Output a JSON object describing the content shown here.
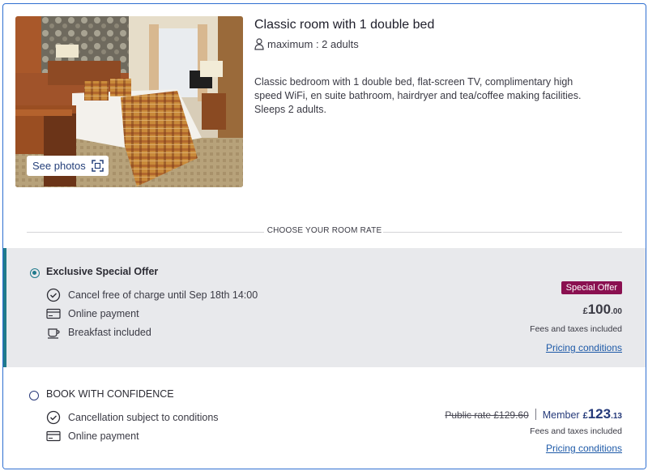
{
  "room": {
    "title": "Classic room with 1 double bed",
    "capacity": "maximum : 2 adults",
    "description": "Classic bedroom with 1 double bed, flat-screen TV, complimentary high speed WiFi, en suite bathroom, hairdryer and tea/coffee making facilities. Sleeps 2 adults.",
    "see_photos_label": "See photos"
  },
  "rate_section_label": "CHOOSE YOUR ROOM RATE",
  "rates": [
    {
      "name": "Exclusive Special Offer",
      "selected": true,
      "features": [
        {
          "icon": "clock-check-icon",
          "label": "Cancel free of charge until Sep 18th 14:00"
        },
        {
          "icon": "card-icon",
          "label": "Online payment"
        },
        {
          "icon": "cup-icon",
          "label": "Breakfast included"
        }
      ],
      "badge": "Special Offer",
      "currency": "£",
      "price_whole": "100",
      "price_cents": ".00",
      "fees_note": "Fees and taxes included",
      "pricing_link": "Pricing conditions"
    },
    {
      "name": "BOOK WITH CONFIDENCE",
      "selected": false,
      "features": [
        {
          "icon": "clock-check-icon",
          "label": "Cancellation subject to conditions"
        },
        {
          "icon": "card-icon",
          "label": "Online payment"
        }
      ],
      "public_rate": "Public rate £129.60",
      "member_label": "Member",
      "currency": "£",
      "price_whole": "123",
      "price_cents": ".13",
      "fees_note": "Fees and taxes included",
      "pricing_link": "Pricing conditions"
    }
  ],
  "colors": {
    "accent": "#1f7a8c",
    "badge": "#8a1050",
    "link": "#1e5aa8",
    "border": "#2f6fd1",
    "selected_bg": "#e8e9ec"
  }
}
